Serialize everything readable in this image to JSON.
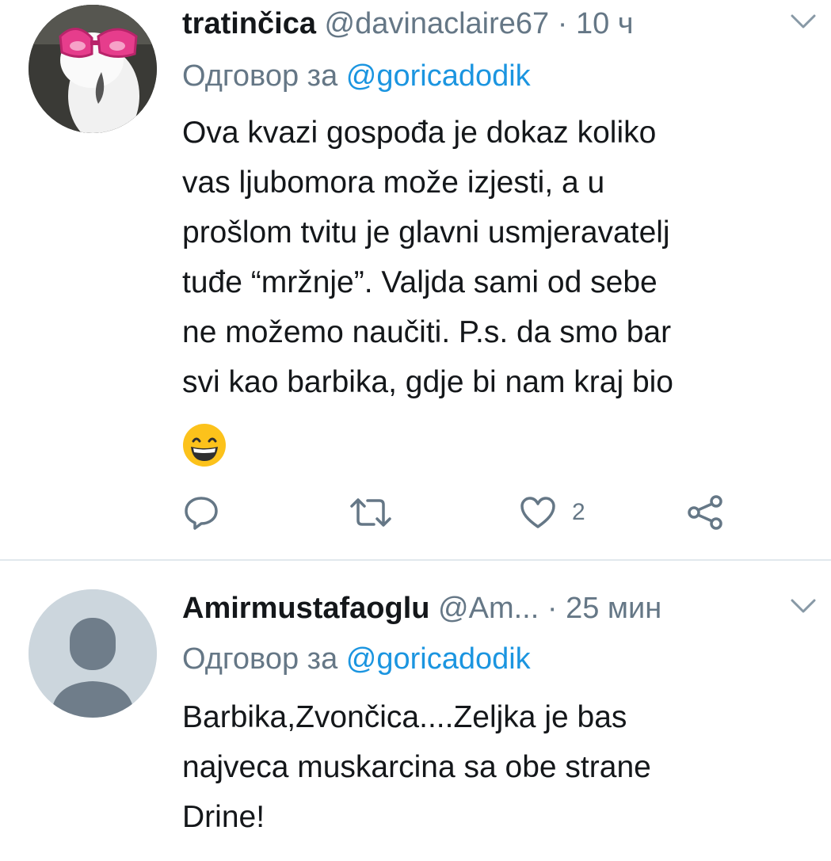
{
  "tweets": [
    {
      "display_name": "tratinčica",
      "handle": "@davinaclaire67",
      "sep": "·",
      "time": "10 ч",
      "replying_prefix": "Одговор за",
      "replying_to": "@goricadodik",
      "text_lines": [
        "Ova kvazi gospođa je dokaz koliko",
        "vas ljubomora može izjesti, a u",
        "prošlom tvitu je glavni usmjeravatelj",
        "tuđe “mržnje”. Valjda sami od sebe",
        "ne možemo naučiti. P.s. da smo bar",
        "svi kao barbika, gdje bi nam kraj bio"
      ],
      "emoji": "grinning-face-with-smiling-eyes-emoji",
      "actions": {
        "reply_icon": "reply-icon",
        "retweet_icon": "retweet-icon",
        "like_icon": "heart-icon",
        "like_count": "2",
        "share_icon": "share-icon"
      }
    },
    {
      "display_name": "Amirmustafaoglu",
      "handle": "@Am...",
      "sep": "·",
      "time": "25 мин",
      "replying_prefix": "Одговор за",
      "replying_to": "@goricadodik",
      "text_lines": [
        "Barbika,Zvončica....Zeljka je bas",
        "najveca muskarcina sa obe strane",
        "Drine!"
      ]
    }
  ],
  "colors": {
    "text": "#14171a",
    "secondary": "#657786",
    "link": "#1b95e0",
    "divider": "#e1e8ed",
    "default_avatar_bg": "#ccd6dd",
    "default_avatar_fg": "#6f7d8a"
  }
}
